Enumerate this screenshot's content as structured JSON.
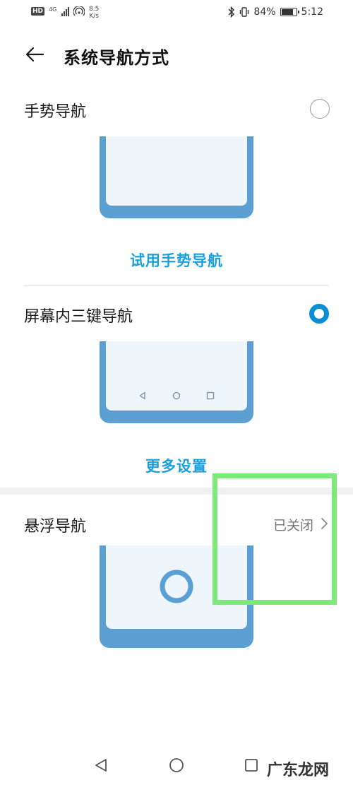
{
  "status_bar": {
    "hd": "HD",
    "network": "4G",
    "speed_value": "8.5",
    "speed_unit": "K/s",
    "battery_percent": "84%",
    "battery_level": 0.84,
    "time": "5:12",
    "icons": [
      "signal-bars-icon",
      "hotspot-icon",
      "bluetooth-icon",
      "vibrate-icon",
      "battery-icon"
    ]
  },
  "header": {
    "title": "系统导航方式"
  },
  "options": [
    {
      "title": "手势导航",
      "selected": false,
      "link": "试用手势导航"
    },
    {
      "title": "屏幕内三键导航",
      "selected": true,
      "link": "更多设置"
    },
    {
      "title": "悬浮导航",
      "status": "已关闭"
    }
  ],
  "watermark": "广东龙网",
  "colors": {
    "accent": "#1aa0dd",
    "radio_on": "#0a8fd6",
    "phone_frame": "#5b9fd3",
    "phone_screen": "#eef6fc",
    "highlight": "#7fe87a"
  }
}
